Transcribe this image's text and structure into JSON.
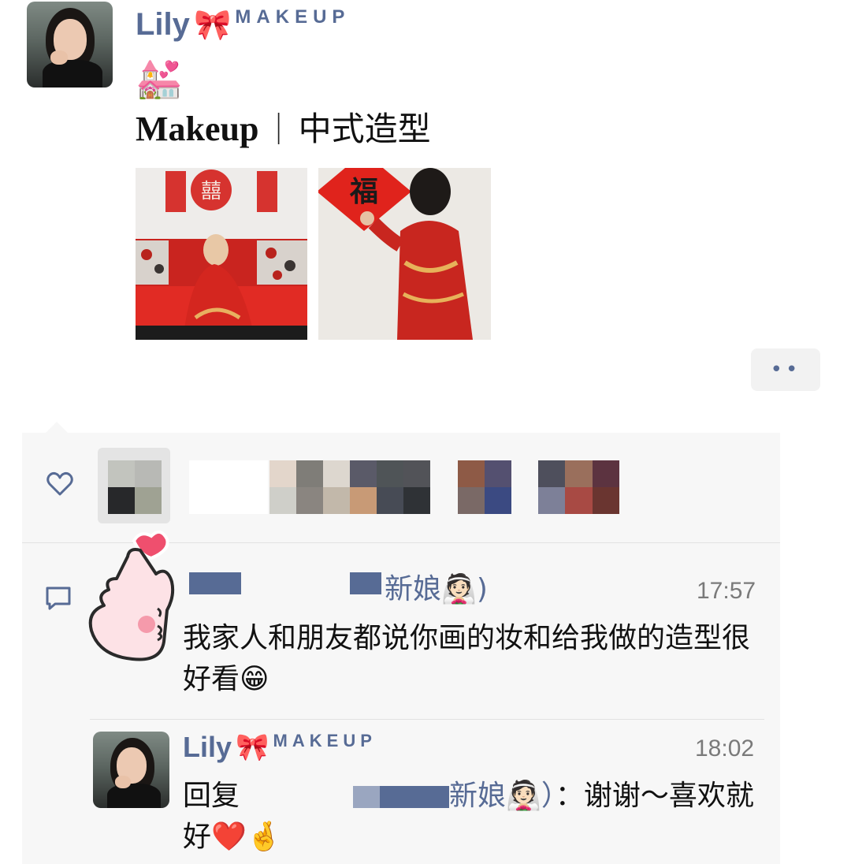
{
  "post": {
    "author_name": "Lily",
    "author_bow": "🎀",
    "author_brand": "MAKEUP",
    "church_emoji": "💒",
    "title_en": "Makeup",
    "title_separator": "｜",
    "title_zh": "中式造型",
    "photos": [
      {
        "alt": "bride seated on red sofa"
      },
      {
        "alt": "bride hanging 福 decoration"
      }
    ],
    "photo2_text": "福",
    "photo1_text": "囍"
  },
  "actions": {
    "more_button_label": "••"
  },
  "likes": {
    "icon": "heart-outline-icon",
    "heart_sticker": "heart"
  },
  "comments": [
    {
      "name_suffix": "新娘👰🏻)",
      "time": "17:57",
      "text": "我家人和朋友都说你画的妆和给我做的造型很好看😁"
    },
    {
      "author_name": "Lily",
      "author_bow": "🎀",
      "author_brand": "MAKEUP",
      "time": "18:02",
      "reply_prefix": "回复",
      "reply_target_suffix": "新娘👰🏻）",
      "text": "：谢谢～喜欢就好❤️🤞"
    }
  ],
  "colors": {
    "link_blue": "#576b95",
    "panel_bg": "#f7f7f7",
    "heart_pink": "#ef4f6e"
  }
}
